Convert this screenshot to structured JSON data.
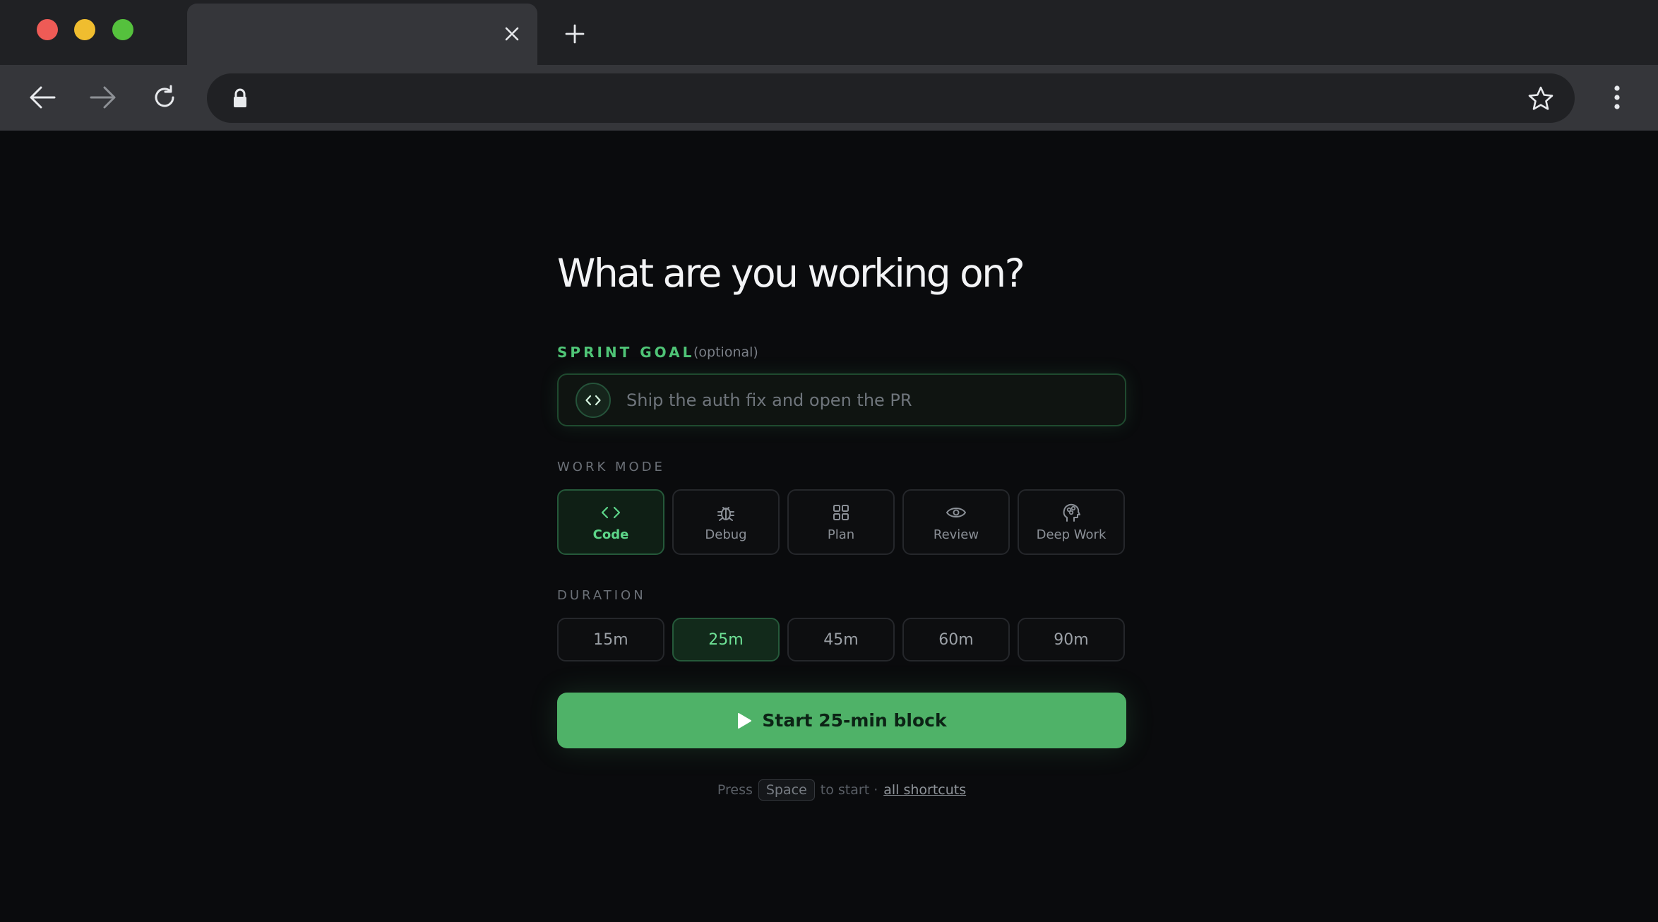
{
  "browser": {
    "tab_title": "",
    "url": "",
    "colors": {
      "tab_bar": "#202124",
      "toolbar": "#35363a"
    }
  },
  "page": {
    "title": "What are you working on?",
    "sprint_goal": {
      "label": "SPRINT GOAL",
      "optional": "(optional)",
      "placeholder": "Ship the auth fix and open the PR",
      "value": "",
      "icon": "code-icon"
    },
    "work_mode": {
      "label": "WORK MODE",
      "options": [
        {
          "label": "Code",
          "icon": "code-icon",
          "selected": true
        },
        {
          "label": "Debug",
          "icon": "bug-icon",
          "selected": false
        },
        {
          "label": "Plan",
          "icon": "grid-icon",
          "selected": false
        },
        {
          "label": "Review",
          "icon": "eye-icon",
          "selected": false
        },
        {
          "label": "Deep Work",
          "icon": "brain-icon",
          "selected": false
        }
      ]
    },
    "duration": {
      "label": "DURATION",
      "options": [
        {
          "label": "15m",
          "selected": false
        },
        {
          "label": "25m",
          "selected": true
        },
        {
          "label": "45m",
          "selected": false
        },
        {
          "label": "60m",
          "selected": false
        },
        {
          "label": "90m",
          "selected": false
        }
      ]
    },
    "start_button": {
      "label": "Start 25-min block",
      "icon": "play-icon"
    },
    "hint": {
      "press": "Press",
      "key": "Space",
      "to_start": "to start ·",
      "link": "all shortcuts"
    },
    "colors": {
      "accent": "#4fb268",
      "accent_text": "#4fc476",
      "background": "#0a0b0d"
    }
  }
}
